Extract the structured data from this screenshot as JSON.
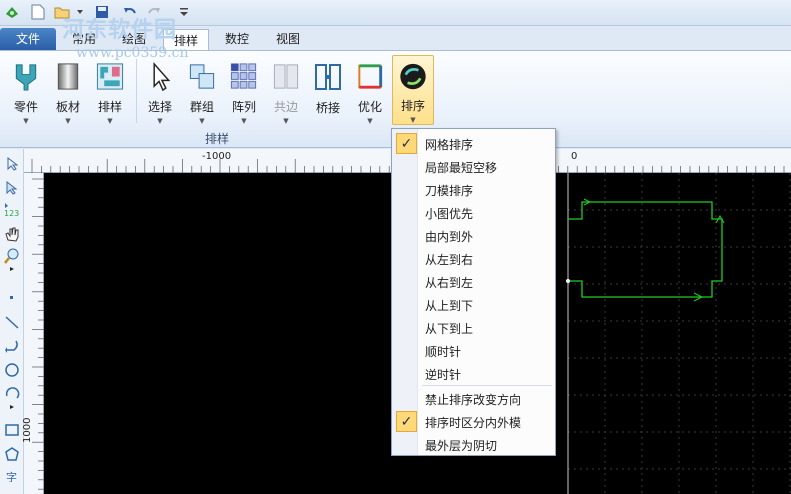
{
  "watermark": {
    "main": "河东软件园",
    "url": "www.pc0359.cn"
  },
  "file_tab": {
    "label": "文件"
  },
  "tabs": [
    {
      "label": "常用",
      "active": false
    },
    {
      "label": "绘图",
      "active": false
    },
    {
      "label": "排样",
      "active": true
    },
    {
      "label": "数控",
      "active": false
    },
    {
      "label": "视图",
      "active": false
    }
  ],
  "ribbon": {
    "group_label": "排样",
    "buttons": [
      {
        "label": "零件",
        "icon": "part-icon"
      },
      {
        "label": "板材",
        "icon": "sheet-icon"
      },
      {
        "label": "排样",
        "icon": "nesting-icon"
      },
      {
        "label": "选择",
        "icon": "select-cursor-icon"
      },
      {
        "label": "群组",
        "icon": "group-icon"
      },
      {
        "label": "阵列",
        "icon": "array-icon"
      },
      {
        "label": "共边",
        "icon": "common-edge-icon",
        "disabled": true
      },
      {
        "label": "桥接",
        "icon": "bridge-icon"
      },
      {
        "label": "优化",
        "icon": "optimize-icon"
      },
      {
        "label": "排序",
        "icon": "sort-icon",
        "highlighted": true
      }
    ]
  },
  "rulers": {
    "h_labels": [
      "-1000",
      "0"
    ],
    "v_labels": [
      "1000"
    ]
  },
  "sort_menu": {
    "items": [
      {
        "label": "网格排序",
        "checked": true
      },
      {
        "label": "局部最短空移",
        "checked": false
      },
      {
        "label": "刀模排序",
        "checked": false
      },
      {
        "label": "小图优先",
        "checked": false
      },
      {
        "label": "由内到外",
        "checked": false
      },
      {
        "label": "从左到右",
        "checked": false
      },
      {
        "label": "从右到左",
        "checked": false
      },
      {
        "label": "从上到下",
        "checked": false
      },
      {
        "label": "从下到上",
        "checked": false
      },
      {
        "label": "顺时针",
        "checked": false
      },
      {
        "label": "逆时针",
        "checked": false
      },
      {
        "label": "禁止排序改变方向",
        "checked": false
      },
      {
        "label": "排序时区分内外模",
        "checked": true
      },
      {
        "label": "最外层为阴切",
        "checked": false
      }
    ]
  },
  "colors": {
    "accent": "#ffd977",
    "canvas": "#000000",
    "part_outline": "#22cc22"
  }
}
